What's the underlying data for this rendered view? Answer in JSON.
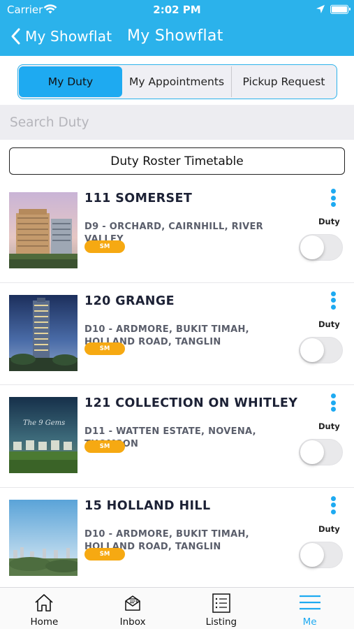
{
  "status_bar": {
    "carrier": "Carrier",
    "time": "2:02 PM"
  },
  "nav": {
    "back_label": "My Showflat",
    "title": "My Showflat"
  },
  "segments": [
    {
      "label": "My Duty",
      "active": true
    },
    {
      "label": "My Appointments",
      "active": false
    },
    {
      "label": "Pickup Request",
      "active": false
    }
  ],
  "search": {
    "placeholder": "Search Duty",
    "value": ""
  },
  "roster_button": "Duty Roster Timetable",
  "listings": [
    {
      "title": "111 SOMERSET",
      "district": "D9 - ORCHARD, CAIRNHILL, RIVER VALLEY",
      "badge": "SM",
      "duty_label": "Duty",
      "duty_on": false,
      "image": "tower-building-photo"
    },
    {
      "title": "120 GRANGE",
      "district": "D10 - ARDMORE, BUKIT TIMAH, HOLLAND ROAD, TANGLIN",
      "badge": "SM",
      "duty_label": "Duty",
      "duty_on": false,
      "image": "highrise-night-photo"
    },
    {
      "title": "121 COLLECTION ON WHITLEY",
      "district": "D11 - WATTEN ESTATE, NOVENA, THOMSON",
      "badge": "SM",
      "duty_label": "Duty",
      "duty_on": false,
      "image": "landed-homes-dusk-photo",
      "image_text": "The 9 Gems"
    },
    {
      "title": "15 HOLLAND HILL",
      "district": "D10 - ARDMORE, BUKIT TIMAH, HOLLAND ROAD, TANGLIN",
      "badge": "SM",
      "duty_label": "Duty",
      "duty_on": false,
      "image": "city-skyline-photo"
    }
  ],
  "tabbar": [
    {
      "label": "Home",
      "icon": "home-icon",
      "active": false
    },
    {
      "label": "Inbox",
      "icon": "inbox-icon",
      "active": false
    },
    {
      "label": "Listing",
      "icon": "listing-icon",
      "active": false
    },
    {
      "label": "Me",
      "icon": "menu-icon",
      "active": true
    }
  ],
  "colors": {
    "header": "#2bb2eb",
    "accent": "#1eaaf1",
    "badge": "#f6a912",
    "search_bg": "#ededf1"
  }
}
